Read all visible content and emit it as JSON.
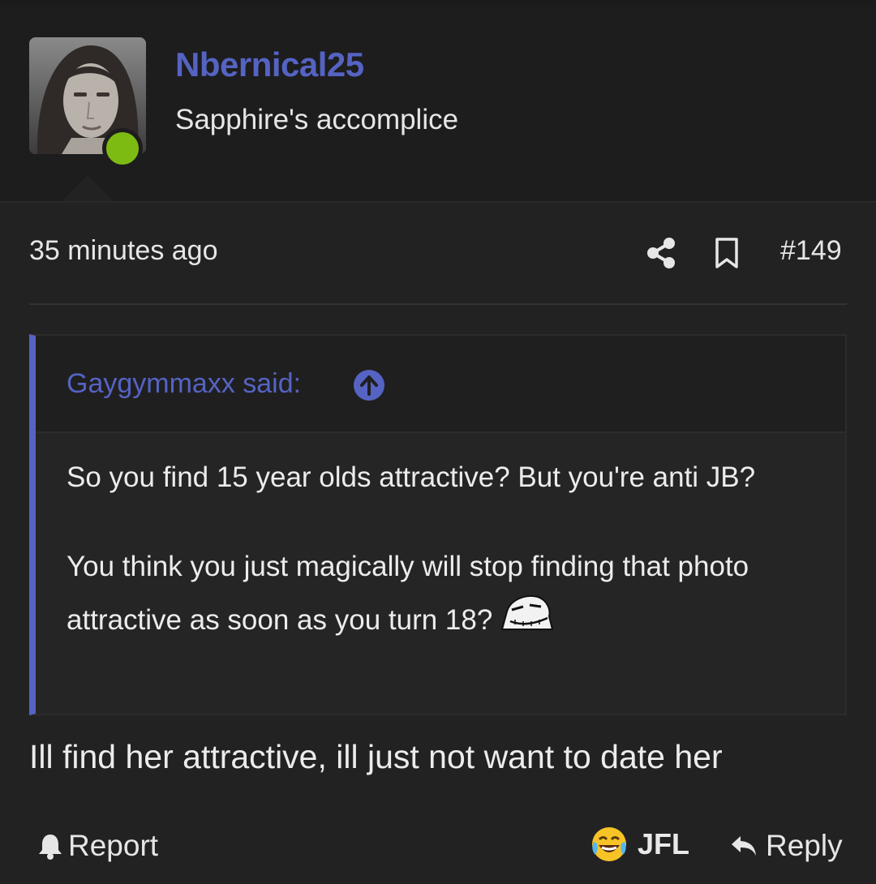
{
  "user": {
    "name": "Nbernical25",
    "title": "Sapphire's accomplice",
    "avatar_icon": "avatar-photo",
    "online_color": "#7dbb12"
  },
  "post": {
    "time": "35 minutes ago",
    "number": "#149",
    "share_icon": "share-icon",
    "bookmark_icon": "bookmark-icon"
  },
  "quote": {
    "author": "Gaygymmaxx said:",
    "line1": "So you find 15 year olds attractive? But you're anti JB?",
    "line2": "You think you just magically will stop finding that photo attractive as soon as you turn 18?",
    "emoji_icon": "troll-face-icon"
  },
  "message": "Ill find her attractive, ill just not want to date her",
  "actions": {
    "report": "Report",
    "reaction": "JFL",
    "reaction_icon": "laughing-crying-emoji-icon",
    "reply": "Reply"
  },
  "colors": {
    "accent": "#5563c3",
    "background": "#222223",
    "text": "#e9e9ea"
  }
}
